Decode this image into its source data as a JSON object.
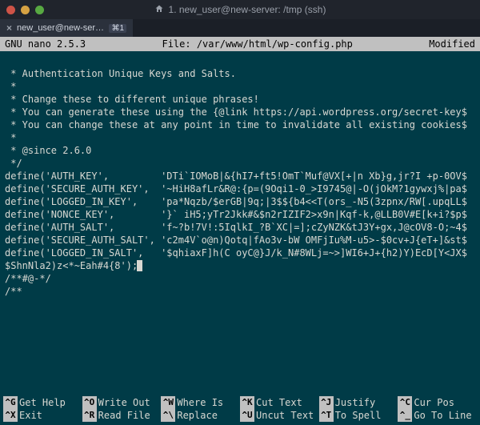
{
  "window": {
    "title": "1. new_user@new-server: /tmp (ssh)"
  },
  "tab": {
    "label": "new_user@new-serv…",
    "index_badge": "⌘1"
  },
  "nano": {
    "version": "GNU nano 2.5.3",
    "file_label": "File: /var/www/html/wp-config.php",
    "status": "Modified"
  },
  "buffer_lines": [
    " * Authentication Unique Keys and Salts.",
    " *",
    " * Change these to different unique phrases!",
    " * You can generate these using the {@link https://api.wordpress.org/secret-key$",
    " * You can change these at any point in time to invalidate all existing cookies$",
    " *",
    " * @since 2.6.0",
    " */",
    "define('AUTH_KEY',         'DTi`IOMoB|&{hI7+ft5!OmT`Muf@VX[+|n Xb}g,jr?I +p-0OV$",
    "define('SECURE_AUTH_KEY',  '~HiH8afLr&R@:{p=(9Oqi1-0_>I9745@|-O(jOkM?1gywxj%|pa$",
    "define('LOGGED_IN_KEY',    'pa*Nqzb/$erGB|9q;|3$${b4<<T(ors_-N5(3zpnx/RW[.upqLL$",
    "define('NONCE_KEY',        '}` iH5;yTr2Jkk#&$n2rIZIF2>x9n|Kqf-k,@LLB0V#E[k+i?$p$",
    "define('AUTH_SALT',        'f~?b!7V!:5IqlkI_?B`XC|=];cZyNZK&tJ3Y+gx,J@cOV8-O;~4$",
    "define('SECURE_AUTH_SALT', 'c2m4V`o@n)Qotq|fAo3v-bW OMFjIu%M-u5>-$0cv+J{eT+]&st$",
    "define('LOGGED_IN_SALT',   '$qhiaxF]h(C oyC@}J/k_N#8WLj=~>]WI6+J+{h2)Y)EcD[Y<JX$",
    "$ShnNla2)z<*~Eah#4{8');",
    "/**#@-*/",
    "",
    "/**"
  ],
  "shortcuts": {
    "row1": [
      {
        "key": "^G",
        "label": "Get Help"
      },
      {
        "key": "^O",
        "label": "Write Out"
      },
      {
        "key": "^W",
        "label": "Where Is"
      },
      {
        "key": "^K",
        "label": "Cut Text"
      },
      {
        "key": "^J",
        "label": "Justify"
      },
      {
        "key": "^C",
        "label": "Cur Pos"
      }
    ],
    "row2": [
      {
        "key": "^X",
        "label": "Exit"
      },
      {
        "key": "^R",
        "label": "Read File"
      },
      {
        "key": "^\\",
        "label": "Replace"
      },
      {
        "key": "^U",
        "label": "Uncut Text"
      },
      {
        "key": "^T",
        "label": "To Spell"
      },
      {
        "key": "^_",
        "label": "Go To Line"
      }
    ]
  }
}
